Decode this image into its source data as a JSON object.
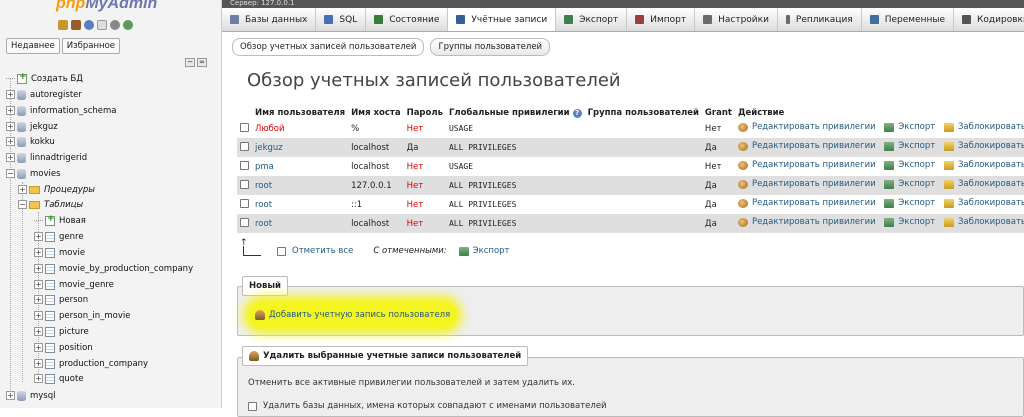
{
  "server_bar": "Сервер: 127.0.0.1",
  "logo": {
    "php": "php",
    "my_admin": "MyAdmin"
  },
  "sidebar": {
    "recent_label": "Недавнее",
    "favorites_label": "Избранное",
    "create_db": "Создать БД",
    "databases": [
      "autoregister",
      "information_schema",
      "jekguz",
      "kokku",
      "linnadtrigerid",
      "movies"
    ],
    "movies_children": {
      "procedures": "Процедуры",
      "tables": "Таблицы",
      "new_table": "Новая",
      "tables_list": [
        "genre",
        "movie",
        "movie_by_production_company",
        "movie_genre",
        "person",
        "person_in_movie",
        "picture",
        "position",
        "production_company",
        "quote"
      ]
    },
    "after_movies": [
      "mysql"
    ]
  },
  "tabs": [
    {
      "label": "Базы данных",
      "icon": "database-icon",
      "color": "#6b7fa3"
    },
    {
      "label": "SQL",
      "icon": "sql-icon",
      "color": "#4a6fb0"
    },
    {
      "label": "Состояние",
      "icon": "status-icon",
      "color": "#3c7a3c"
    },
    {
      "label": "Учётные записи",
      "icon": "users-icon",
      "color": "#335f9a",
      "active": true
    },
    {
      "label": "Экспорт",
      "icon": "export-icon",
      "color": "#3f7f4f"
    },
    {
      "label": "Импорт",
      "icon": "import-icon",
      "color": "#9a3f3f"
    },
    {
      "label": "Настройки",
      "icon": "wrench-icon",
      "color": "#6a6a6a"
    },
    {
      "label": "Репликация",
      "icon": "replication-icon",
      "color": "#6a6a6a"
    },
    {
      "label": "Переменные",
      "icon": "variables-icon",
      "color": "#3f6f9a"
    },
    {
      "label": "Кодировки",
      "icon": "charset-icon",
      "color": "#555"
    }
  ],
  "subtabs": {
    "overview": "Обзор учетных записей пользователей",
    "groups": "Группы пользователей"
  },
  "page_title": "Обзор учетных записей пользователей",
  "table": {
    "headers": {
      "user": "Имя пользователя",
      "host": "Имя хоста",
      "password": "Пароль",
      "privileges": "Глобальные привилегии",
      "group": "Группа пользователей",
      "grant": "Grant",
      "action": "Действие"
    },
    "rows": [
      {
        "user": "Любой",
        "host": "%",
        "password": "Нет",
        "privileges": "USAGE",
        "grant": "Нет"
      },
      {
        "user": "jekguz",
        "host": "localhost",
        "password": "Да",
        "privileges": "ALL PRIVILEGES",
        "grant": "Да"
      },
      {
        "user": "pma",
        "host": "localhost",
        "password": "Нет",
        "privileges": "USAGE",
        "grant": "Нет"
      },
      {
        "user": "root",
        "host": "127.0.0.1",
        "password": "Нет",
        "privileges": "ALL PRIVILEGES",
        "grant": "Да"
      },
      {
        "user": "root",
        "host": "::1",
        "password": "Нет",
        "privileges": "ALL PRIVILEGES",
        "grant": "Да"
      },
      {
        "user": "root",
        "host": "localhost",
        "password": "Нет",
        "privileges": "ALL PRIVILEGES",
        "grant": "Да"
      }
    ],
    "actions": {
      "edit": "Редактировать привилегии",
      "export": "Экспорт",
      "lock": "Заблокировать"
    }
  },
  "bulk": {
    "check_all": "Отметить все",
    "with_selected": "С отмеченными:",
    "export": "Экспорт"
  },
  "new_section": {
    "legend": "Новый",
    "add_user": "Добавить учетную запись пользователя"
  },
  "remove_section": {
    "legend": "Удалить выбранные учетные записи пользователей",
    "description": "Отменить все активные привилегии пользователей и затем удалить их.",
    "drop_db": "Удалить базы данных, имена которых совпадают с именами пользователей"
  }
}
